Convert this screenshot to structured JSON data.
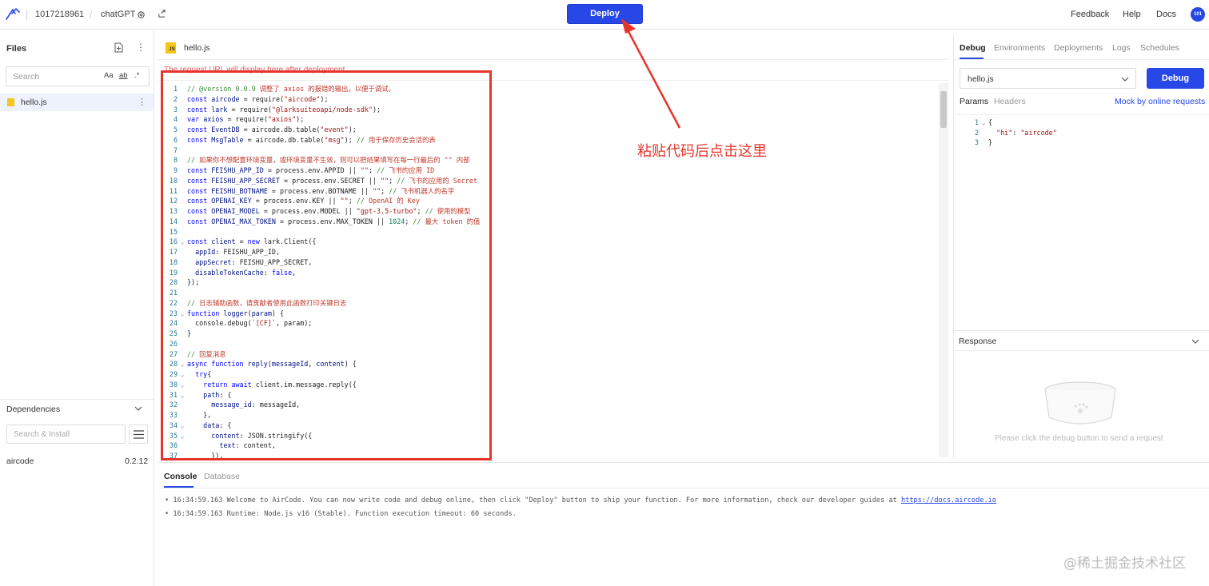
{
  "topbar": {
    "app_id": "1017218961",
    "project": "chatGPT",
    "deploy_label": "Deploy",
    "links": [
      "Feedback",
      "Help",
      "Docs"
    ],
    "avatar_text": "101"
  },
  "files": {
    "title": "Files",
    "search_placeholder": "Search",
    "search_opts": [
      "Aa",
      "ab",
      ".*"
    ],
    "items": [
      {
        "name": "hello.js"
      }
    ]
  },
  "dependencies": {
    "title": "Dependencies",
    "search_placeholder": "Search & Install",
    "items": [
      {
        "name": "aircode",
        "version": "0.2.12"
      }
    ]
  },
  "editor": {
    "tab_name": "hello.js",
    "url_hint": "The request URL will display here after deployment",
    "lines": [
      {
        "n": "1",
        "f": "",
        "h": "<span class='cm'>// @version 0.0.9 </span><span class='cmzh'>调整了 axios 的报错的输出，以便于调试。</span>"
      },
      {
        "n": "2",
        "f": "",
        "h": "<span class='kw'>const</span> <span class='vr'>aircode</span> = require(<span class='st'>\"aircode\"</span>);"
      },
      {
        "n": "3",
        "f": "",
        "h": "<span class='kw'>const</span> <span class='vr'>lark</span> = require(<span class='st'>\"@larksuiteoapi/node-sdk\"</span>);"
      },
      {
        "n": "4",
        "f": "",
        "h": "<span class='kw'>var</span> <span class='vr'>axios</span> = require(<span class='st'>\"axios\"</span>);"
      },
      {
        "n": "5",
        "f": "",
        "h": "<span class='kw'>const</span> <span class='vr'>EventDB</span> = aircode.db.table(<span class='st'>\"event\"</span>);"
      },
      {
        "n": "6",
        "f": "",
        "h": "<span class='kw'>const</span> <span class='vr'>MsgTable</span> = aircode.db.table(<span class='st'>\"msg\"</span>); <span class='cm'>// </span><span class='cmzh'>用于保存历史会话的表</span>"
      },
      {
        "n": "7",
        "f": "",
        "h": ""
      },
      {
        "n": "8",
        "f": "",
        "h": "<span class='cm'>// </span><span class='cmzh'>如果你不想配置环境变量，或环境变量不生效，则可以把结果填写在每一行最后的 \"\" 内部</span>"
      },
      {
        "n": "9",
        "f": "",
        "h": "<span class='kw'>const</span> <span class='vr'>FEISHU_APP_ID</span> = process.env.APPID || <span class='st'>\"\"</span>; <span class='cm'>// </span><span class='cmzh'>飞书的应用 ID</span>"
      },
      {
        "n": "10",
        "f": "",
        "h": "<span class='kw'>const</span> <span class='vr'>FEISHU_APP_SECRET</span> = process.env.SECRET || <span class='st'>\"\"</span>; <span class='cm'>// </span><span class='cmzh'>飞书的应用的 Secret</span>"
      },
      {
        "n": "11",
        "f": "",
        "h": "<span class='kw'>const</span> <span class='vr'>FEISHU_BOTNAME</span> = process.env.BOTNAME || <span class='st'>\"\"</span>; <span class='cm'>// </span><span class='cmzh'>飞书机器人的名字</span>"
      },
      {
        "n": "12",
        "f": "",
        "h": "<span class='kw'>const</span> <span class='vr'>OPENAI_KEY</span> = process.env.KEY || <span class='st'>\"\"</span>; <span class='cm'>// </span><span class='cmzh'>OpenAI 的 Key</span>"
      },
      {
        "n": "13",
        "f": "",
        "h": "<span class='kw'>const</span> <span class='vr'>OPENAI_MODEL</span> = process.env.MODEL || <span class='st'>\"gpt-3.5-turbo\"</span>; <span class='cm'>// </span><span class='cmzh'>使用的模型</span>"
      },
      {
        "n": "14",
        "f": "",
        "h": "<span class='kw'>const</span> <span class='vr'>OPENAI_MAX_TOKEN</span> = process.env.MAX_TOKEN || <span class='nu'>1024</span>; <span class='cm'>// </span><span class='cmzh'>最大 token 的值</span>"
      },
      {
        "n": "15",
        "f": "",
        "h": ""
      },
      {
        "n": "16",
        "f": "⌄",
        "h": "<span class='kw'>const</span> <span class='vr'>client</span> = <span class='kw'>new</span> lark.Client({"
      },
      {
        "n": "17",
        "f": "",
        "h": "  <span class='vr'>appId</span>: FEISHU_APP_ID,"
      },
      {
        "n": "18",
        "f": "",
        "h": "  <span class='vr'>appSecret</span>: FEISHU_APP_SECRET,"
      },
      {
        "n": "19",
        "f": "",
        "h": "  <span class='vr'>disableTokenCache</span>: <span class='kw'>false</span>,"
      },
      {
        "n": "20",
        "f": "",
        "h": "});"
      },
      {
        "n": "21",
        "f": "",
        "h": ""
      },
      {
        "n": "22",
        "f": "",
        "h": "<span class='cm'>// </span><span class='cmzh'>日志辅助函数，请贡献者使用此函数打印关键日志</span>"
      },
      {
        "n": "23",
        "f": "⌄",
        "h": "<span class='kw'>function</span> <span class='vr'>logger</span>(<span class='vr'>param</span>) {"
      },
      {
        "n": "24",
        "f": "",
        "h": "  console.debug(<span class='st'>`[CF]`</span>, param);"
      },
      {
        "n": "25",
        "f": "",
        "h": "}"
      },
      {
        "n": "26",
        "f": "",
        "h": ""
      },
      {
        "n": "27",
        "f": "",
        "h": "<span class='cm'>// </span><span class='cmzh'>回复消息</span>"
      },
      {
        "n": "28",
        "f": "⌄",
        "h": "<span class='kw'>async function</span> <span class='vr'>reply</span>(<span class='vr'>messageId</span>, <span class='vr'>content</span>) {"
      },
      {
        "n": "29",
        "f": "⌄",
        "h": "  <span class='kw'>try</span>{"
      },
      {
        "n": "30",
        "f": "⌄",
        "h": "    <span class='kw'>return await</span> client.im.message.reply({"
      },
      {
        "n": "31",
        "f": "⌄",
        "h": "    <span class='vr'>path</span>: {"
      },
      {
        "n": "32",
        "f": "",
        "h": "      <span class='vr'>message_id</span>: messageId,"
      },
      {
        "n": "33",
        "f": "",
        "h": "    },"
      },
      {
        "n": "34",
        "f": "⌄",
        "h": "    <span class='vr'>data</span>: {"
      },
      {
        "n": "35",
        "f": "⌄",
        "h": "      <span class='vr'>content</span>: JSON.stringify({"
      },
      {
        "n": "36",
        "f": "",
        "h": "        <span class='vr'>text</span>: content,"
      },
      {
        "n": "37",
        "f": "",
        "h": "      }),"
      }
    ]
  },
  "debug_panel": {
    "tabs": [
      "Debug",
      "Environments",
      "Deployments",
      "Logs",
      "Schedules"
    ],
    "file_select": "hello.js",
    "debug_label": "Debug",
    "params_tab": "Params",
    "headers_tab": "Headers",
    "mock_link": "Mock by online requests",
    "params_lines": [
      {
        "n": "1",
        "f": "⌄",
        "h": "{"
      },
      {
        "n": "2",
        "f": "",
        "h": "  <span class='st'>\"hi\"</span>: <span class='st'>\"aircode\"</span>"
      },
      {
        "n": "3",
        "f": "",
        "h": "}"
      }
    ],
    "response_title": "Response",
    "empty_text": "Please click the debug button to send a request"
  },
  "console": {
    "tabs": [
      "Console",
      "Database"
    ],
    "lines": [
      {
        "time": "16:34:59.163",
        "text": " Welcome to AirCode. You can now write code and debug online, then click \"Deploy\" button to ship your function. For more information, check our developer guides at ",
        "link": "https://docs.aircode.io"
      },
      {
        "time": "16:34:59.163",
        "text": " Runtime: Node.js v16 (Stable). Function execution timeout: 60 seconds.",
        "link": ""
      }
    ]
  },
  "annotation": {
    "text": "粘贴代码后点击这里",
    "color": "#e8352c"
  },
  "watermark": "@稀土掘金技术社区",
  "colors": {
    "accent": "#2747e6",
    "annotation": "#e8352c"
  }
}
